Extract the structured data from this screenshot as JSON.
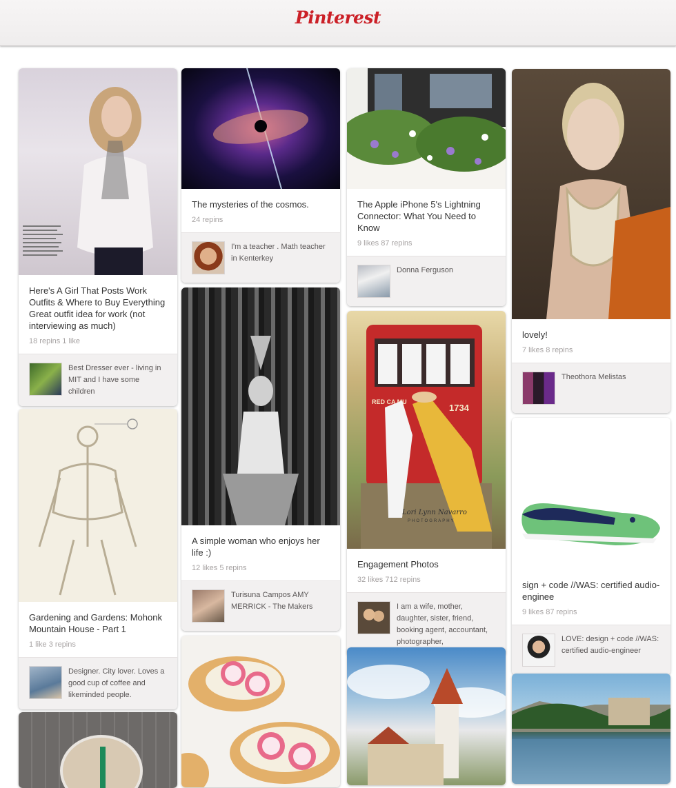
{
  "header": {
    "logo": "Pinterest"
  },
  "pins": [
    {
      "desc": "Here's A Girl That Posts Work Outfits & Where to Buy Everything Great outfit idea for work (not interviewing as much)",
      "likes": "",
      "repins": "18 repins 1 like",
      "pinner": "Best Dresser ever - living in MIT and I have some children"
    },
    {
      "desc": "Gardening and Gardens: Mohonk Mountain House - Part 1",
      "repins": "1 like 3 repins",
      "pinner": "Designer. City lover. Loves a good cup of coffee and likeminded people."
    },
    {
      "desc": "The mysteries of the cosmos.",
      "repins": "24 repins",
      "pinner": "I'm a teacher . Math teacher in Kenterkey"
    },
    {
      "desc": "A simple woman who enjoys her life :)",
      "repins": "12 likes 5 repins",
      "pinner": "Turisuna Campos AMY MERRICK - The Makers"
    },
    {
      "desc": "The Apple iPhone 5's Lightning Connector: What You Need to Know",
      "repins": "9 likes 87 repins",
      "pinner": "Donna Ferguson"
    },
    {
      "desc": "Engagement Photos",
      "repins": "32 likes 712 repins",
      "pinner": "I am a wife, mother, daughter, sister, friend, booking agent, accountant, photographer,"
    },
    {
      "desc": "lovely!",
      "repins": "7 likes 8 repins",
      "pinner": "Theothora Melistas"
    },
    {
      "desc": "sign + code //WAS: certified audio-enginee",
      "repins": "9 likes 87 repins",
      "pinner": "LOVE: design + code //WAS: certified audio-engineer"
    }
  ],
  "image_overlays": {
    "train_number": "1734",
    "train_sign": "RED CA MU",
    "watermark_name": "Lori Lynn Navarro",
    "watermark_sub": "PHOTOGRAPHY"
  },
  "colors": {
    "brand": "#cb2027",
    "footer_bg": "#f2f0f0",
    "stats": "#a7a3a3"
  }
}
